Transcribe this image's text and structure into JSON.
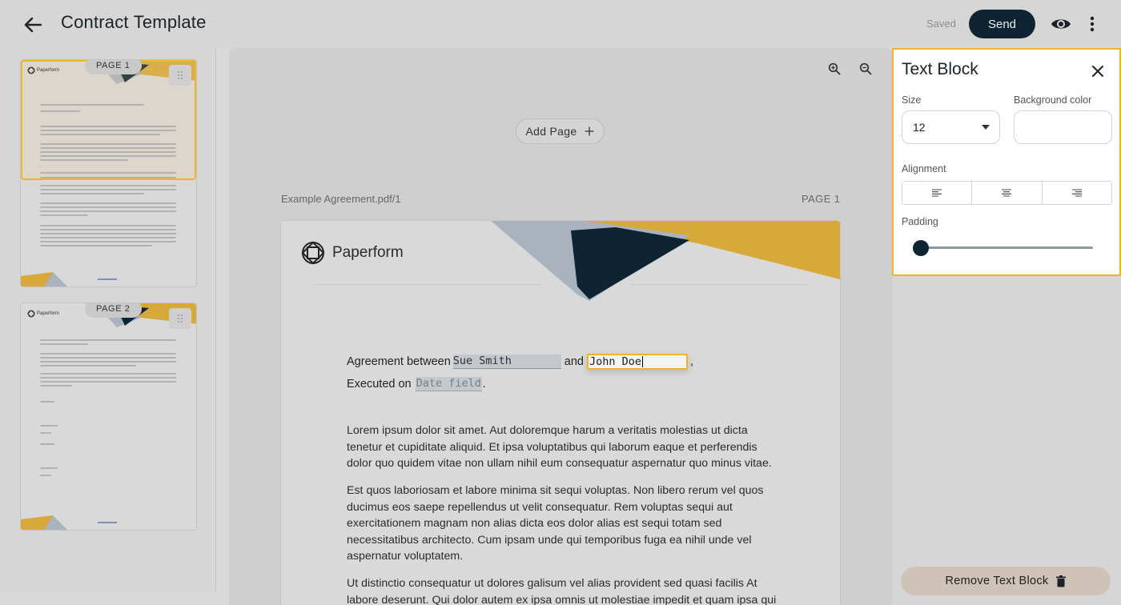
{
  "header": {
    "title": "Contract Template",
    "saved_status": "Saved",
    "send_label": "Send"
  },
  "thumbnails": [
    {
      "badge": "PAGE 1",
      "logo": "Paperform"
    },
    {
      "badge": "PAGE 2",
      "logo": "Paperform"
    }
  ],
  "canvas": {
    "add_page_label": "Add Page",
    "document_name": "Example Agreement.pdf/1",
    "page_label": "PAGE 1"
  },
  "page": {
    "logo_text": "Paperform",
    "agreement_prefix": "Agreement between",
    "party1_value": "Sue Smith",
    "and_text": "and",
    "party2_value": "John Doe",
    "comma": ",",
    "executed_prefix": "Executed on",
    "date_placeholder": "Date field",
    "period": ".",
    "paragraphs": [
      "Lorem ipsum dolor sit amet. Aut doloremque harum a veritatis molestias ut dicta tenetur et cupiditate aliquid. Et ipsa voluptatibus qui laborum eaque et perferendis dolor quo quidem vitae non ullam nihil eum consequatur aspernatur quo minus vitae.",
      "Est quos laboriosam et labore minima sit sequi voluptas. Non libero rerum vel quos ducimus eos saepe repellendus ut velit consequatur. Rem voluptas sequi aut exercitationem magnam non alias dicta eos dolor alias est sequi totam sed necessitatibus architecto. Cum ipsam unde qui temporibus fuga ea nihil unde vel aspernatur voluptatem.",
      "Ut distinctio consequatur ut dolores galisum vel alias provident sed quasi facilis At labore deserunt. Qui dolor autem ex ipsa omnis ut molestiae impedit et quam ipsa qui"
    ]
  },
  "panel": {
    "title": "Text Block",
    "size_label": "Size",
    "size_value": "12",
    "background_label": "Background color",
    "alignment_label": "Alignment",
    "padding_label": "Padding",
    "padding_value": 0,
    "remove_label": "Remove Text Block"
  },
  "colors": {
    "accent": "#f0b429",
    "navy": "#0e2432",
    "slate": "#9aa4ae"
  }
}
